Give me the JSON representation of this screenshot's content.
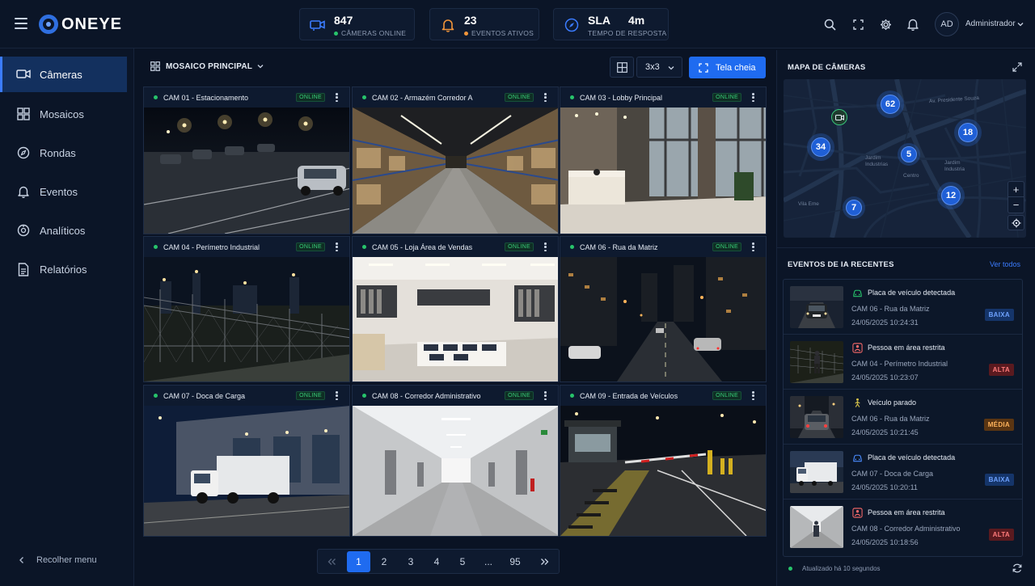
{
  "app": {
    "brand": "ONEYE"
  },
  "kpis": [
    {
      "value": "847",
      "label": "CÂMERAS ONLINE",
      "dot": "#27c46b"
    },
    {
      "value": "23",
      "label": "EVENTOS ATIVOS",
      "dot": "#f2953a"
    },
    {
      "value": "SLA",
      "value2": "4m",
      "label": "TEMPO DE RESPOSTA"
    }
  ],
  "user": {
    "initials": "AD",
    "name": "Administrador"
  },
  "sidebar": {
    "items": [
      {
        "label": "Câmeras",
        "icon": "camera-icon",
        "active": true
      },
      {
        "label": "Mosaicos",
        "icon": "grid-icon"
      },
      {
        "label": "Rondas",
        "icon": "compass-icon"
      },
      {
        "label": "Eventos",
        "icon": "bell-icon"
      },
      {
        "label": "Analíticos",
        "icon": "analytics-icon"
      },
      {
        "label": "Relatórios",
        "icon": "report-icon"
      }
    ],
    "collapse_label": "Recolher menu"
  },
  "mosaic": {
    "title": "MOSAICO PRINCIPAL",
    "grid_size": "3x3",
    "fullscreen_label": "Tela cheia",
    "status_label": "ONLINE",
    "cameras": [
      {
        "name": "CAM 01 - Estacionamento"
      },
      {
        "name": "CAM 02 - Armazém Corredor A"
      },
      {
        "name": "CAM 03 - Lobby Principal"
      },
      {
        "name": "CAM 04 - Perímetro Industrial"
      },
      {
        "name": "CAM 05 - Loja Área de Vendas"
      },
      {
        "name": "CAM 06 - Rua da Matriz"
      },
      {
        "name": "CAM 07 - Doca de Carga"
      },
      {
        "name": "CAM 08 - Corredor Administrativo"
      },
      {
        "name": "CAM 09 - Entrada de Veículos"
      }
    ]
  },
  "pagination": {
    "pages": [
      "1",
      "2",
      "3",
      "4",
      "5",
      "...",
      "95"
    ],
    "current": "1"
  },
  "map": {
    "title": "MAPA DE CÂMERAS",
    "clusters": [
      "62",
      "18",
      "34",
      "5",
      "12",
      "7"
    ],
    "labels": [
      "Av. Presidente Souza",
      "Jardim Industrias",
      "Jardim Industria",
      "Centro",
      "Vila Eme"
    ]
  },
  "events": {
    "title": "EVENTOS DE IA RECENTES",
    "see_all": "Ver todos",
    "items": [
      {
        "title": "Placa de veículo detectada",
        "camera": "CAM 06 - Rua da Matriz",
        "time": "24/05/2025 10:24:31",
        "severity": "BAIXA",
        "icon": "car-icon"
      },
      {
        "title": "Pessoa em área restrita",
        "camera": "CAM 04 - Perímetro Industrial",
        "time": "24/05/2025 10:23:07",
        "severity": "ALTA",
        "icon": "person-alert-icon"
      },
      {
        "title": "Veículo parado",
        "camera": "CAM 06 - Rua da Matriz",
        "time": "24/05/2025 10:21:45",
        "severity": "MÉDIA",
        "icon": "person-walk-icon"
      },
      {
        "title": "Placa de veículo detectada",
        "camera": "CAM 07 - Doca de Carga",
        "time": "24/05/2025 10:20:11",
        "severity": "BAIXA",
        "icon": "car-icon"
      },
      {
        "title": "Pessoa em área restrita",
        "camera": "CAM 08 - Corredor Administrativo",
        "time": "24/05/2025 10:18:56",
        "severity": "ALTA",
        "icon": "person-alert-icon"
      }
    ],
    "updated": "Atualizado há 10 segundos"
  },
  "colors": {
    "accent": "#1f6bf0",
    "online": "#27c46b",
    "high": "#ff7b7b",
    "medium": "#ffb35c",
    "low": "#6ea2ff"
  }
}
